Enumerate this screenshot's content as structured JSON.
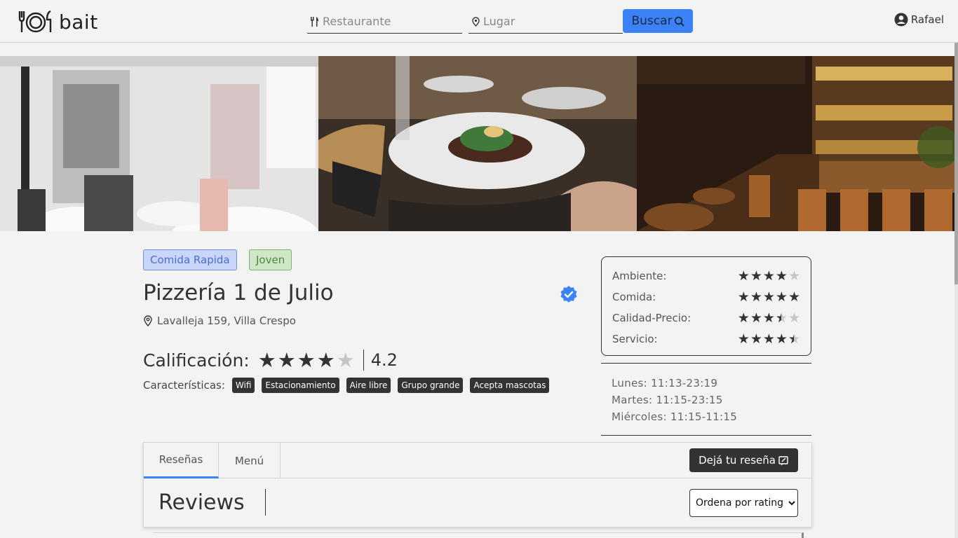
{
  "header": {
    "logo_text": "bait",
    "restaurant_placeholder": "Restaurante",
    "place_placeholder": "Lugar",
    "search_label": "Buscar",
    "user_name": "Rafael"
  },
  "hero": {
    "images": [
      "dining-room-photo",
      "plated-dish-photo",
      "bar-interior-photo"
    ]
  },
  "restaurant": {
    "tags": [
      "Comida Rapida",
      "Joven"
    ],
    "name": "Pizzería 1 de Julio",
    "verified": true,
    "address": "Lavalleja 159, Villa Crespo",
    "rating_label": "Calificación:",
    "rating_value": "4.2",
    "rating_stars": 4,
    "features_label": "Características:",
    "features": [
      "Wifi",
      "Estacionamiento",
      "Aire libre",
      "Grupo grande",
      "Acepta mascotas"
    ]
  },
  "categories": [
    {
      "label": "Ambiente:",
      "stars": 4
    },
    {
      "label": "Comida:",
      "stars": 5
    },
    {
      "label": "Calidad-Precio:",
      "stars": 3.5
    },
    {
      "label": "Servicio:",
      "stars": 4.5
    }
  ],
  "hours": [
    "Lunes: 11:13-23:19",
    "Martes: 11:15-23:15",
    "Miércoles: 11:15-11:15"
  ],
  "tabs": {
    "reviews": "Reseñas",
    "menu": "Menú",
    "write_review": "Dejá tu reseña"
  },
  "reviews": {
    "title": "Reviews",
    "sort_selected": "Ordena por rating"
  },
  "colors": {
    "accent": "#3b82f6",
    "dark": "#333333",
    "background": "#f3f3f3"
  }
}
